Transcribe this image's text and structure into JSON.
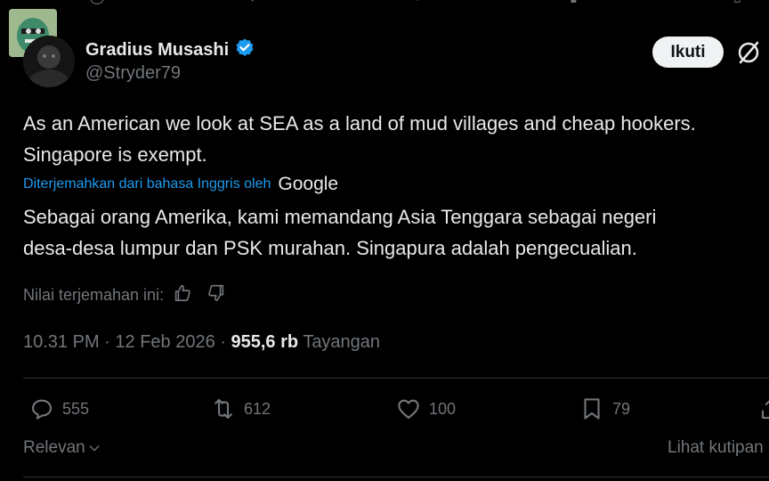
{
  "tweet": {
    "author_name": "Gradius Musashi",
    "author_handle": "@Stryder79",
    "follow_label": "Ikuti",
    "text_line1": "As an American we look at SEA as a land of mud villages and cheap hookers.",
    "text_line2": "Singapore is exempt.",
    "translated_from_label": "Diterjemahkan dari bahasa Inggris oleh",
    "translator_brand": "Google",
    "translated_line1": "Sebagai orang Amerika, kami memandang Asia Tenggara sebagai negeri",
    "translated_line2": "desa-desa lumpur dan PSK murahan. Singapura adalah pengecualian.",
    "rate_label": "Nilai terjemahan ini:",
    "time": "10.31 PM",
    "date": "12 Feb 2026",
    "views_count": "955,6 rb",
    "views_label": "Tayangan"
  },
  "actions": {
    "replies": "555",
    "retweets": "612",
    "likes": "100",
    "bookmarks": "79"
  },
  "footer": {
    "sort_label": "Relevan",
    "quotes_link": "Lihat kutipan"
  },
  "colors": {
    "background": "#000000",
    "text": "#e7e9ea",
    "muted": "#71767b",
    "accent": "#1d9bf0",
    "verified": "#1d9bf0"
  }
}
